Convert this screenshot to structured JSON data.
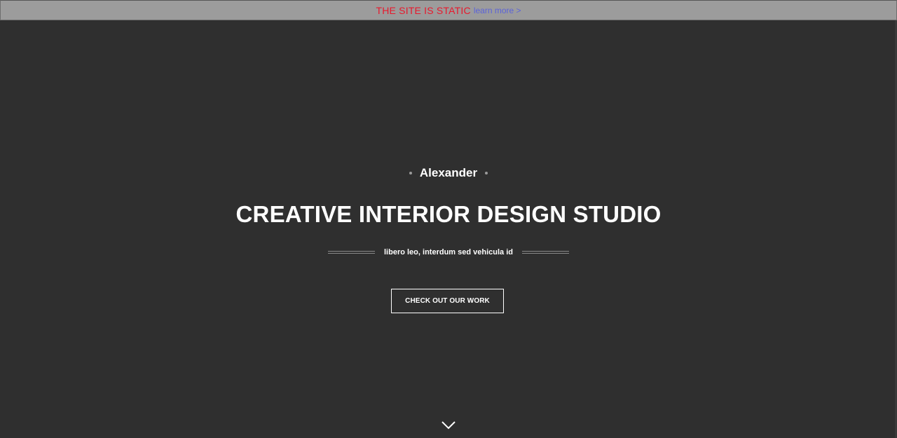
{
  "banner": {
    "text": "THE SITE IS STATIC",
    "link_label": "learn more >",
    "text_color": "#e8182c",
    "link_color": "#5b63d9",
    "background": "#9c9c9c"
  },
  "hero": {
    "background": "#2f2f2f",
    "name": "Alexander",
    "title": "CREATIVE INTERIOR DESIGN STUDIO",
    "tagline": "libero leo, interdum sed vehicula id",
    "cta_label": "CHECK OUT OUR WORK",
    "scroll_icon": "chevron-down-icon"
  }
}
